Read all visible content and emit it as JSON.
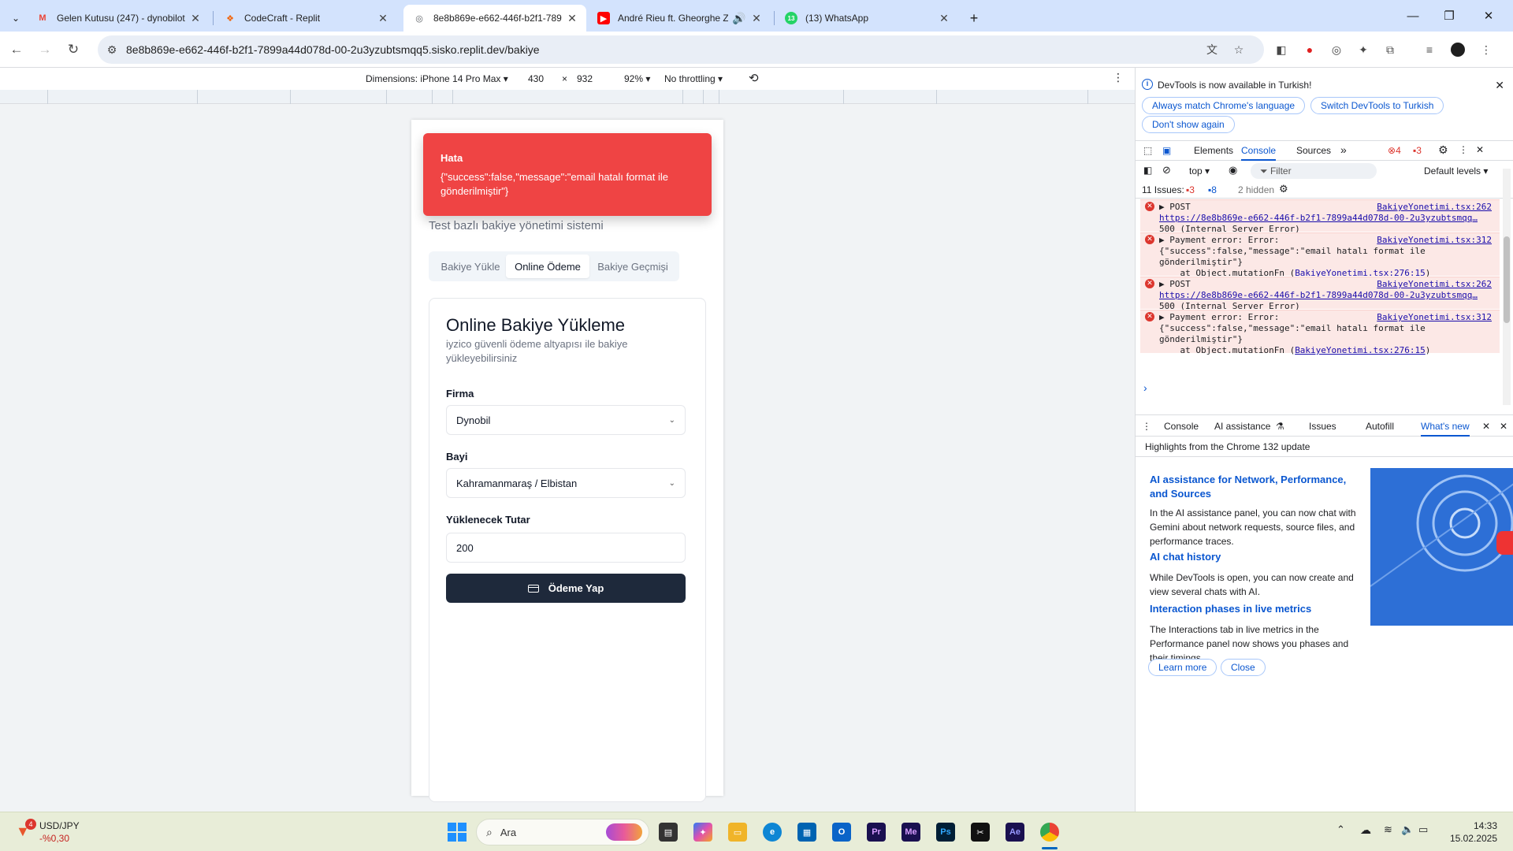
{
  "tabs": [
    {
      "title": "Gelen Kutusu (247) - dynobilot",
      "icon": "gmail-icon",
      "color": "#ea4335",
      "glyph": "M"
    },
    {
      "title": "CodeCraft - Replit",
      "icon": "replit-icon",
      "color": "#f26207",
      "glyph": "R"
    },
    {
      "title": "8e8b869e-e662-446f-b2f1-789",
      "icon": "globe-icon",
      "color": "#5f6368",
      "glyph": "◎"
    },
    {
      "title": "André Rieu ft. Gheorghe Za",
      "icon": "youtube-icon",
      "color": "#ff0000",
      "glyph": "▶"
    },
    {
      "title": "(13) WhatsApp",
      "icon": "whatsapp-icon",
      "color": "#25d366",
      "glyph": "13"
    }
  ],
  "address": {
    "url": "8e8b869e-e662-446f-b2f1-7899a44d078d-00-2u3yzubtsmqq5.sisko.replit.dev/bakiye"
  },
  "device_toolbar": {
    "dimensions": "Dimensions: iPhone 14 Pro Max ▾",
    "width": "430",
    "times": "×",
    "height": "932",
    "zoom": "92% ▾",
    "throttle": "No throttling ▾"
  },
  "page": {
    "toast": {
      "title": "Hata",
      "message": "{\"success\":false,\"message\":\"email hatalı format ile gönderilmiştir\"}"
    },
    "subtitle": "Test bazlı bakiye yönetimi sistemi",
    "tabs": [
      "Bakiye Yükle",
      "Online Ödeme",
      "Bakiye Geçmişi"
    ],
    "card": {
      "title": "Online Bakiye Yükleme",
      "description": "iyzico güvenli ödeme altyapısı ile bakiye yükleyebilirsiniz",
      "firma_label": "Firma",
      "firma_value": "Dynobil",
      "bayi_label": "Bayi",
      "bayi_value": "Kahramanmaraş / Elbistan",
      "tutar_label": "Yüklenecek Tutar",
      "tutar_value": "200",
      "pay_button": "Ödeme Yap"
    }
  },
  "devtools": {
    "info": "DevTools is now available in Turkish!",
    "btn_match": "Always match Chrome's language",
    "btn_switch": "Switch DevTools to Turkish",
    "btn_dont": "Don't show again",
    "tabs": [
      "Elements",
      "Console",
      "Sources",
      "»"
    ],
    "error_count": "4",
    "warn_count": "3",
    "context": "top ▾",
    "filter_placeholder": "Filter",
    "levels": "Default levels ▾",
    "issues": "11 Issues:",
    "issues_err": "3",
    "issues_info": "8",
    "hidden": "2 hidden",
    "messages": [
      {
        "kind": "post",
        "head": "▶ POST",
        "src": "BakiyeYonetimi.tsx:262",
        "link": "https://8e8b869e-e662-446f-b2f1-7899a44d078d-00-2u3yzubtsmqq…",
        "status": "500 (Internal Server Error)"
      },
      {
        "kind": "error",
        "head": "▶ Payment error: Error:",
        "src": "BakiyeYonetimi.tsx:312",
        "l2": "{\"success\":false,\"message\":\"email hatalı format ile",
        "l3": "gönderilmiştir\"}",
        "l4a": "    at Object.mutationFn (",
        "l4b": "BakiyeYonetimi.tsx:276:15",
        "l4c": ")"
      },
      {
        "kind": "post",
        "head": "▶ POST",
        "src": "BakiyeYonetimi.tsx:262",
        "link": "https://8e8b869e-e662-446f-b2f1-7899a44d078d-00-2u3yzubtsmqq…",
        "status": "500 (Internal Server Error)"
      },
      {
        "kind": "error",
        "head": "▶ Payment error: Error:",
        "src": "BakiyeYonetimi.tsx:312",
        "l2": "{\"success\":false,\"message\":\"email hatalı format ile",
        "l3": "gönderilmiştir\"}",
        "l4a": "    at Object.mutationFn (",
        "l4b": "BakiyeYonetimi.tsx:276:15",
        "l4c": ")"
      }
    ],
    "prompt": "›",
    "drawer_tabs": [
      "Console",
      "AI assistance",
      "Issues",
      "Autofill",
      "What's new"
    ],
    "whatsnew": {
      "header": "Highlights from the Chrome 132 update",
      "h1": "AI assistance for Network, Performance, and Sources",
      "p1": "In the AI assistance panel, you can now chat with Gemini about network requests, source files, and performance traces.",
      "h2": "AI chat history",
      "p2": "While DevTools is open, you can now create and view several chats with AI.",
      "h3": "Interaction phases in live metrics",
      "p3": "The Interactions tab in live metrics in the Performance panel now shows you phases and their timings.",
      "learn_more": "Learn more",
      "close": "Close"
    }
  },
  "taskbar": {
    "widget_title": "USD/JPY",
    "widget_value": "-%0,30",
    "widget_badge": "4",
    "search_placeholder": "Ara",
    "time": "14:33",
    "date": "15.02.2025"
  }
}
